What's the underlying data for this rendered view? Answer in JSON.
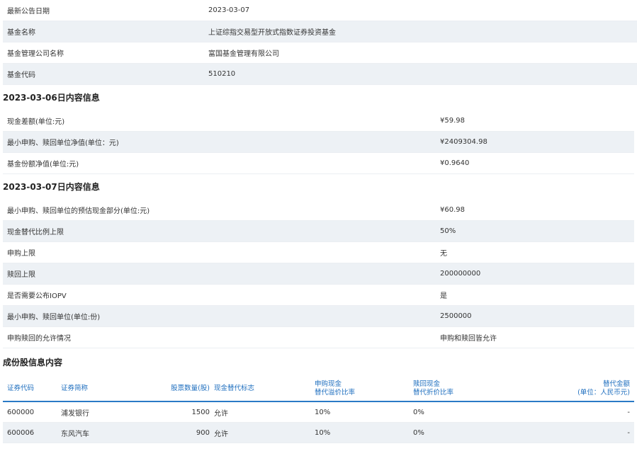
{
  "basic": [
    {
      "label": "最新公告日期",
      "value": "2023-03-07"
    },
    {
      "label": "基金名称",
      "value": "上证综指交易型开放式指数证券投资基金"
    },
    {
      "label": "基金管理公司名称",
      "value": "富国基金管理有限公司"
    },
    {
      "label": "基金代码",
      "value": "510210"
    }
  ],
  "section_0306": {
    "title": "2023-03-06日内容信息",
    "rows": [
      {
        "label": "现金差额(单位:元)",
        "value": "¥59.98"
      },
      {
        "label": "最小申购、赎回单位净值(单位：元)",
        "value": "¥2409304.98"
      },
      {
        "label": "基金份额净值(单位:元)",
        "value": "¥0.9640"
      }
    ]
  },
  "section_0307": {
    "title": "2023-03-07日内容信息",
    "rows": [
      {
        "label": "最小申购、赎回单位的预估现金部分(单位:元)",
        "value": "¥60.98"
      },
      {
        "label": "现金替代比例上限",
        "value": "50%"
      },
      {
        "label": "申购上限",
        "value": "无"
      },
      {
        "label": "赎回上限",
        "value": "200000000"
      },
      {
        "label": "是否需要公布IOPV",
        "value": "是"
      },
      {
        "label": "最小申购、赎回单位(单位:份)",
        "value": "2500000"
      },
      {
        "label": "申购赎回的允许情况",
        "value": "申购和赎回皆允许"
      }
    ]
  },
  "components": {
    "title": "成份股信息内容",
    "headers": {
      "code": "证券代码",
      "name": "证券简称",
      "shares": "股票数量(股)",
      "flag": "现金替代标志",
      "sub_line1": "申购现金",
      "sub_line2": "替代溢价比率",
      "red_line1": "赎回现金",
      "red_line2": "替代折价比率",
      "amt_line1": "替代金额",
      "amt_line2": "(单位：人民币元)"
    },
    "rows": [
      {
        "code": "600000",
        "name": "浦发银行",
        "shares": "1500",
        "flag": "允许",
        "sub": "10%",
        "red": "0%",
        "amt": "-"
      },
      {
        "code": "600006",
        "name": "东风汽车",
        "shares": "900",
        "flag": "允许",
        "sub": "10%",
        "red": "0%",
        "amt": "-"
      }
    ]
  }
}
